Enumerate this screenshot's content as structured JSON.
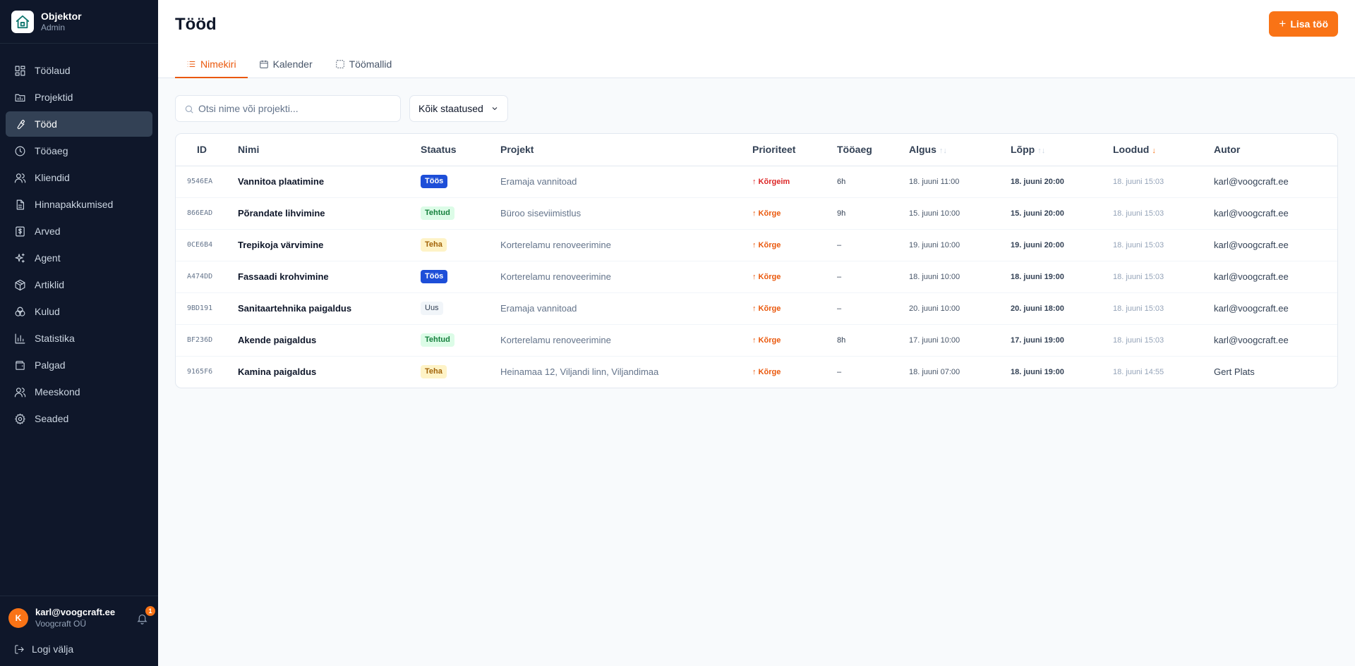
{
  "brand": {
    "name": "Objektor",
    "role": "Admin",
    "icon": "house-icon"
  },
  "nav": [
    {
      "label": "Töölaud",
      "icon": "dashboard-icon",
      "active": false
    },
    {
      "label": "Projektid",
      "icon": "folder-icon",
      "active": false
    },
    {
      "label": "Tööd",
      "icon": "wrench-icon",
      "active": true
    },
    {
      "label": "Tööaeg",
      "icon": "clock-icon",
      "active": false
    },
    {
      "label": "Kliendid",
      "icon": "users-icon",
      "active": false
    },
    {
      "label": "Hinnapakkumised",
      "icon": "document-icon",
      "active": false
    },
    {
      "label": "Arved",
      "icon": "invoice-icon",
      "active": false
    },
    {
      "label": "Agent",
      "icon": "sparkles-icon",
      "active": false
    },
    {
      "label": "Artiklid",
      "icon": "package-icon",
      "active": false
    },
    {
      "label": "Kulud",
      "icon": "coins-icon",
      "active": false
    },
    {
      "label": "Statistika",
      "icon": "bar-chart-icon",
      "active": false
    },
    {
      "label": "Palgad",
      "icon": "wallet-icon",
      "active": false
    },
    {
      "label": "Meeskond",
      "icon": "team-icon",
      "active": false
    },
    {
      "label": "Seaded",
      "icon": "gear-icon",
      "active": false
    }
  ],
  "user": {
    "initial": "K",
    "email": "karl@voogcraft.ee",
    "company": "Voogcraft OÜ",
    "notifications": "1"
  },
  "logout_label": "Logi välja",
  "page": {
    "title": "Tööd",
    "add_label": "Lisa töö"
  },
  "tabs": [
    {
      "label": "Nimekiri",
      "icon": "list-icon",
      "active": true
    },
    {
      "label": "Kalender",
      "icon": "calendar-icon",
      "active": false
    },
    {
      "label": "Töömallid",
      "icon": "template-icon",
      "active": false
    }
  ],
  "filters": {
    "search_placeholder": "Otsi nime või projekti...",
    "search_value": "",
    "status_selected": "Kõik staatused"
  },
  "table": {
    "columns": {
      "id": "ID",
      "name": "Nimi",
      "status": "Staatus",
      "project": "Projekt",
      "priority": "Prioriteet",
      "time": "Tööaeg",
      "start": "Algus",
      "end": "Lõpp",
      "created": "Loodud",
      "author": "Autor"
    },
    "sort_column": "Loodud",
    "sort_direction": "desc",
    "rows": [
      {
        "id": "9546EA",
        "name": "Vannitoa plaatimine",
        "status": "Töös",
        "status_type": "progress",
        "project": "Eramaja vannitoad",
        "priority": "↑ Kõrgeim",
        "priority_level": "highest",
        "time": "6h",
        "start": "18. juuni 11:00",
        "end": "18. juuni 20:00",
        "created": "18. juuni 15:03",
        "author": "karl@voogcraft.ee"
      },
      {
        "id": "866EAD",
        "name": "Põrandate lihvimine",
        "status": "Tehtud",
        "status_type": "done",
        "project": "Büroo siseviimistlus",
        "priority": "↑ Kõrge",
        "priority_level": "high",
        "time": "9h",
        "start": "15. juuni 10:00",
        "end": "15. juuni 20:00",
        "created": "18. juuni 15:03",
        "author": "karl@voogcraft.ee"
      },
      {
        "id": "0CE6B4",
        "name": "Trepikoja värvimine",
        "status": "Teha",
        "status_type": "todo",
        "project": "Korterelamu renoveerimine",
        "priority": "↑ Kõrge",
        "priority_level": "high",
        "time": "–",
        "start": "19. juuni 10:00",
        "end": "19. juuni 20:00",
        "created": "18. juuni 15:03",
        "author": "karl@voogcraft.ee"
      },
      {
        "id": "A474DD",
        "name": "Fassaadi krohvimine",
        "status": "Töös",
        "status_type": "progress",
        "project": "Korterelamu renoveerimine",
        "priority": "↑ Kõrge",
        "priority_level": "high",
        "time": "–",
        "start": "18. juuni 10:00",
        "end": "18. juuni 19:00",
        "created": "18. juuni 15:03",
        "author": "karl@voogcraft.ee"
      },
      {
        "id": "9BD191",
        "name": "Sanitaartehnika paigaldus",
        "status": "Uus",
        "status_type": "new",
        "project": "Eramaja vannitoad",
        "priority": "↑ Kõrge",
        "priority_level": "high",
        "time": "–",
        "start": "20. juuni 10:00",
        "end": "20. juuni 18:00",
        "created": "18. juuni 15:03",
        "author": "karl@voogcraft.ee"
      },
      {
        "id": "BF236D",
        "name": "Akende paigaldus",
        "status": "Tehtud",
        "status_type": "done",
        "project": "Korterelamu renoveerimine",
        "priority": "↑ Kõrge",
        "priority_level": "high",
        "time": "8h",
        "start": "17. juuni 10:00",
        "end": "17. juuni 19:00",
        "created": "18. juuni 15:03",
        "author": "karl@voogcraft.ee"
      },
      {
        "id": "9165F6",
        "name": "Kamina paigaldus",
        "status": "Teha",
        "status_type": "todo",
        "project": "Heinamaa 12, Viljandi linn, Viljandimaa",
        "priority": "↑ Kõrge",
        "priority_level": "high",
        "time": "–",
        "start": "18. juuni 07:00",
        "end": "18. juuni 19:00",
        "created": "18. juuni 14:55",
        "author": "Gert Plats"
      }
    ]
  },
  "colors": {
    "accent": "#f97316",
    "sidebar_bg": "#0f172a",
    "active_nav": "#334155",
    "in_progress": "#1d4ed8",
    "done_bg": "#dcfce7",
    "todo_bg": "#fef3c7",
    "highest_priority": "#dc2626",
    "high_priority": "#ea580c"
  }
}
